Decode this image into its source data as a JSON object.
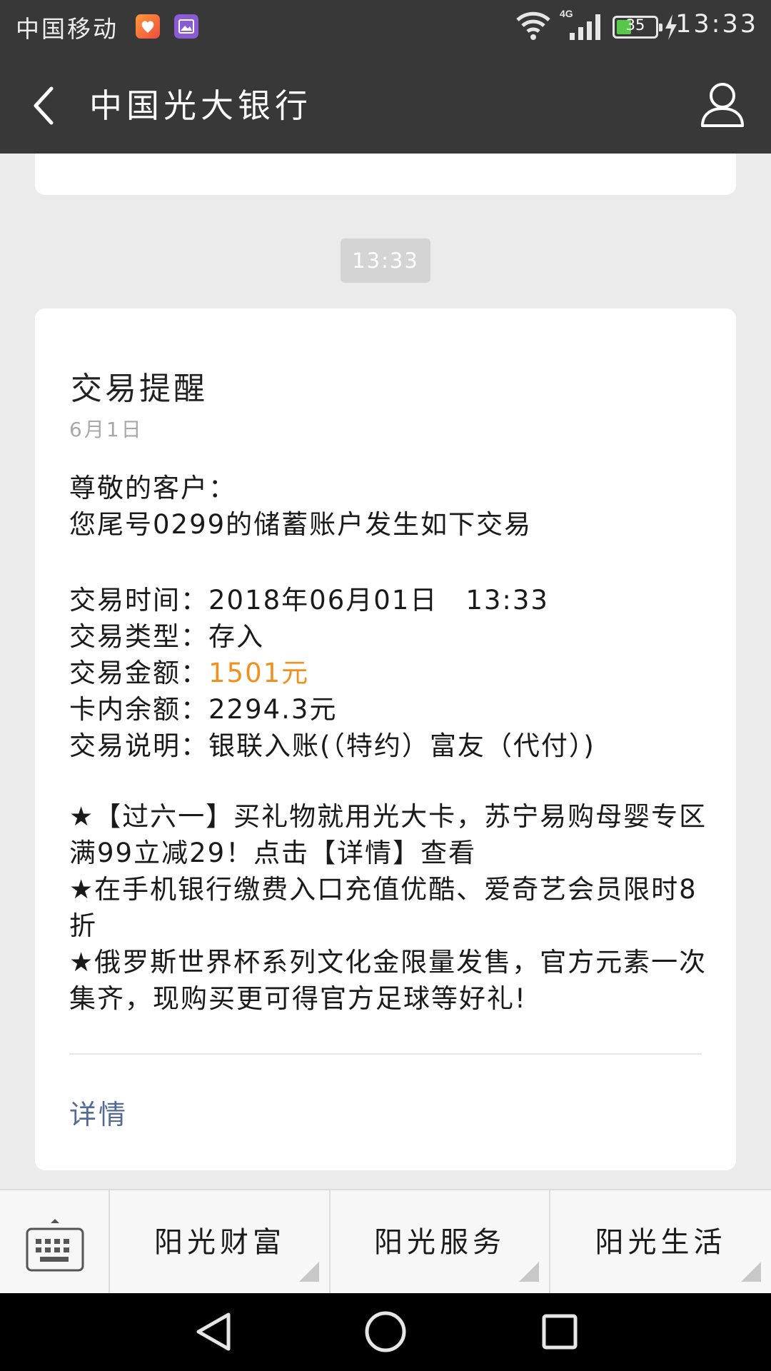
{
  "status_bar": {
    "carrier": "中国移动",
    "network": "4G",
    "battery": "35",
    "time": "13:33"
  },
  "header": {
    "title": "中国光大银行"
  },
  "chat": {
    "timestamp": "13:33",
    "message": {
      "title": "交易提醒",
      "date": "6月1日",
      "greeting": "尊敬的客户：",
      "intro": "您尾号0299的储蓄账户发生如下交易",
      "time_label": "交易时间：",
      "time_value": "2018年06月01日　13:33",
      "type_label": "交易类型：",
      "type_value": "存入",
      "amount_label": "交易金额：",
      "amount_value": "1501元",
      "balance_label": "卡内余额：",
      "balance_value": "2294.3元",
      "desc_label": "交易说明：",
      "desc_value": "银联入账(（特约）富友（代付）)",
      "promos": [
        "★【过六一】买礼物就用光大卡，苏宁易购母婴专区满99立减29！点击【详情】查看",
        "★在手机银行缴费入口充值优酷、爱奇艺会员限时8折",
        "★俄罗斯世界杯系列文化金限量发售，官方元素一次集齐，现购买更可得官方足球等好礼!"
      ],
      "link_label": "详情"
    }
  },
  "bottom_menu": {
    "items": [
      "阳光财富",
      "阳光服务",
      "阳光生活"
    ]
  },
  "colors": {
    "header_bg": "#383838",
    "amount": "#f0901e",
    "link": "#536b93",
    "battery": "#58c84a"
  },
  "icons": [
    "health-app-icon",
    "gallery-app-icon",
    "wifi-icon",
    "signal-icon",
    "battery-icon",
    "charging-icon",
    "back-arrow-icon",
    "profile-icon",
    "keyboard-icon",
    "nav-back-icon",
    "nav-home-icon",
    "nav-recents-icon"
  ]
}
